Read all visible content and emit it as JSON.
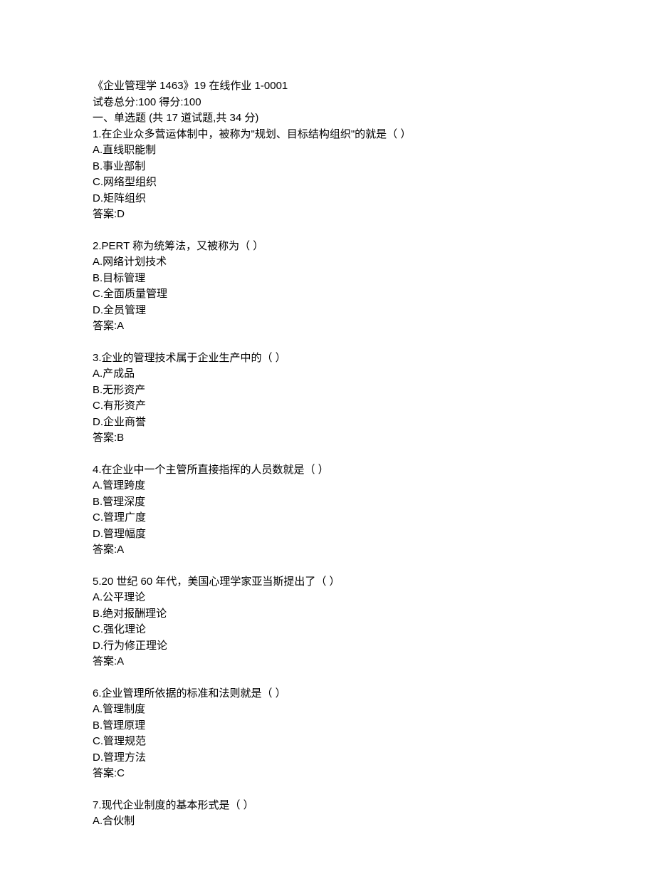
{
  "header": {
    "title": "《企业管理学 1463》19 在线作业 1-0001",
    "score_line": "试卷总分:100    得分:100",
    "section_title": "一、单选题 (共 17 道试题,共 34 分)"
  },
  "questions": [
    {
      "stem": "1.在企业众多营运体制中，被称为\"规划、目标结构组织\"的就是（ ）",
      "options": {
        "A": "A.直线职能制",
        "B": "B.事业部制",
        "C": "C.网络型组织",
        "D": "D.矩阵组织"
      },
      "answer": "答案:D"
    },
    {
      "stem": "2.PERT 称为统筹法，又被称为（ ）",
      "options": {
        "A": "A.网络计划技术",
        "B": "B.目标管理",
        "C": "C.全面质量管理",
        "D": "D.全员管理"
      },
      "answer": "答案:A"
    },
    {
      "stem": "3.企业的管理技术属于企业生产中的（ ）",
      "options": {
        "A": "A.产成品",
        "B": "B.无形资产",
        "C": "C.有形资产",
        "D": "D.企业商誉"
      },
      "answer": "答案:B"
    },
    {
      "stem": "4.在企业中一个主管所直接指挥的人员数就是（ ）",
      "options": {
        "A": "A.管理跨度",
        "B": "B.管理深度",
        "C": "C.管理广度",
        "D": "D.管理幅度"
      },
      "answer": "答案:A"
    },
    {
      "stem": "5.20 世纪 60 年代，美国心理学家亚当斯提出了（ ）",
      "options": {
        "A": "A.公平理论",
        "B": "B.绝对报酬理论",
        "C": "C.强化理论",
        "D": "D.行为修正理论"
      },
      "answer": "答案:A"
    },
    {
      "stem": "6.企业管理所依据的标准和法则就是（ ）",
      "options": {
        "A": "A.管理制度",
        "B": "B.管理原理",
        "C": "C.管理规范",
        "D": "D.管理方法"
      },
      "answer": "答案:C"
    },
    {
      "stem": "7.现代企业制度的基本形式是（ ）",
      "options": {
        "A": "A.合伙制"
      },
      "answer": null
    }
  ]
}
